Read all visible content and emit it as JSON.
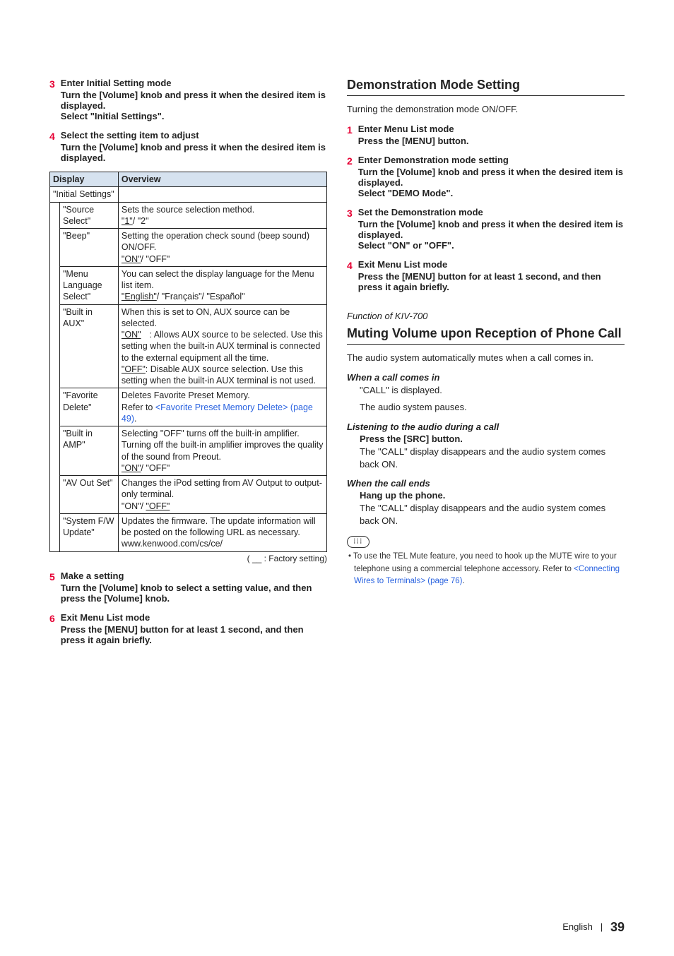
{
  "left": {
    "steps_top": [
      {
        "num": "3",
        "title": "Enter Initial Setting mode",
        "action": "Turn the [Volume] knob and press it when the desired item is displayed.\nSelect \"Initial Settings\"."
      },
      {
        "num": "4",
        "title": "Select the setting item to adjust",
        "action": "Turn the [Volume] knob and press it when the desired item is displayed."
      }
    ],
    "table": {
      "head_display": "Display",
      "head_overview": "Overview",
      "rows": [
        {
          "display": "\"Initial Settings\"",
          "overview": "",
          "span": true
        },
        {
          "display": "\"Source Select\"",
          "overview_plain1": "Sets the source selection method.",
          "overview_opts": "\"1\"/ \"2\"",
          "default": "\"1\""
        },
        {
          "display": "\"Beep\"",
          "overview_plain1": "Setting the operation check sound (beep sound) ON/OFF.",
          "overview_opts": "\"ON\"/ \"OFF\"",
          "default": "\"ON\""
        },
        {
          "display": "\"Menu Language Select\"",
          "overview_plain1": "You can select the display language for the Menu list item.",
          "overview_opts": "\"English\"/ \"Français\"/ \"Español\"",
          "default": "\"English\""
        },
        {
          "display": "\"Built in AUX\"",
          "overview_plain1": "When this is set to ON, AUX source can be selected.",
          "on_label": "\"ON\"",
          "on_desc": ": Allows AUX source to be selected. Use this setting when the built-in AUX terminal is connected to the external equipment all the time.",
          "off_label": "\"OFF\"",
          "off_desc": ": Disable AUX source selection. Use this setting when the built-in AUX terminal is not used."
        },
        {
          "display": "\"Favorite Delete\"",
          "overview_plain1": "Deletes Favorite Preset Memory.",
          "overview_link_pre": "Refer to ",
          "overview_link": "<Favorite Preset Memory Delete> (page 49)",
          "overview_link_post": "."
        },
        {
          "display": "\"Built in AMP\"",
          "overview_plain1": "Selecting \"OFF\" turns off the built-in amplifier. Turning off the built-in amplifier improves the quality of the sound from Preout.",
          "overview_opts": "\"ON\"/ \"OFF\"",
          "default": "\"ON\""
        },
        {
          "display": "\"AV Out Set\"",
          "overview_plain1": "Changes the iPod setting from AV Output to output-only terminal.",
          "overview_opts": "\"ON\"/ \"OFF\"",
          "default": "\"OFF\""
        },
        {
          "display": "\"System F/W Update\"",
          "overview_plain1": "Updates the firmware. The update information will be posted on the following URL as necessary.",
          "overview_plain2": "www.kenwood.com/cs/ce/"
        }
      ]
    },
    "factory_note": "(  __  : Factory setting)",
    "steps_bottom": [
      {
        "num": "5",
        "title": "Make a setting",
        "action": "Turn the [Volume] knob to select a setting value, and then press the [Volume] knob."
      },
      {
        "num": "6",
        "title": "Exit Menu List mode",
        "action": "Press the [MENU] button for at least 1 second, and then press it again briefly."
      }
    ]
  },
  "right": {
    "sec1": {
      "title": "Demonstration Mode Setting",
      "intro": "Turning the demonstration mode ON/OFF.",
      "steps": [
        {
          "num": "1",
          "title": "Enter Menu List mode",
          "action": "Press the [MENU] button."
        },
        {
          "num": "2",
          "title": "Enter Demonstration mode setting",
          "action": "Turn the [Volume] knob and press it when the desired item is displayed.\nSelect \"DEMO Mode\"."
        },
        {
          "num": "3",
          "title": "Set the Demonstration mode",
          "action": "Turn the [Volume] knob and press it when the desired item is displayed.\nSelect \"ON\" or \"OFF\"."
        },
        {
          "num": "4",
          "title": "Exit Menu List mode",
          "action": "Press the [MENU] button for at least 1 second, and then press it again briefly."
        }
      ]
    },
    "sec2": {
      "func_of": "Function of KIV-700",
      "title": "Muting Volume upon Reception of Phone Call",
      "intro": "The audio system automatically mutes when a call comes in.",
      "blocks": [
        {
          "head": "When a call comes in",
          "lines": [
            "\"CALL\" is displayed.",
            "The audio system pauses."
          ]
        },
        {
          "head": "Listening to the audio during a call",
          "action": "Press the [SRC] button.",
          "text": "The \"CALL\" display disappears and the audio system comes back ON."
        },
        {
          "head": "When the call ends",
          "action": "Hang up the phone.",
          "text": "The \"CALL\" display disappears and the audio system comes back ON."
        }
      ],
      "note_icon": "⁝⁝⁝",
      "note_pre": "• To use the TEL Mute feature, you need to hook up the MUTE wire to your telephone using a commercial telephone accessory.  Refer to ",
      "note_link": "<Connecting Wires to Terminals> (page 76)",
      "note_post": "."
    }
  },
  "footer": {
    "lang": "English",
    "sep": "|",
    "page": "39"
  }
}
